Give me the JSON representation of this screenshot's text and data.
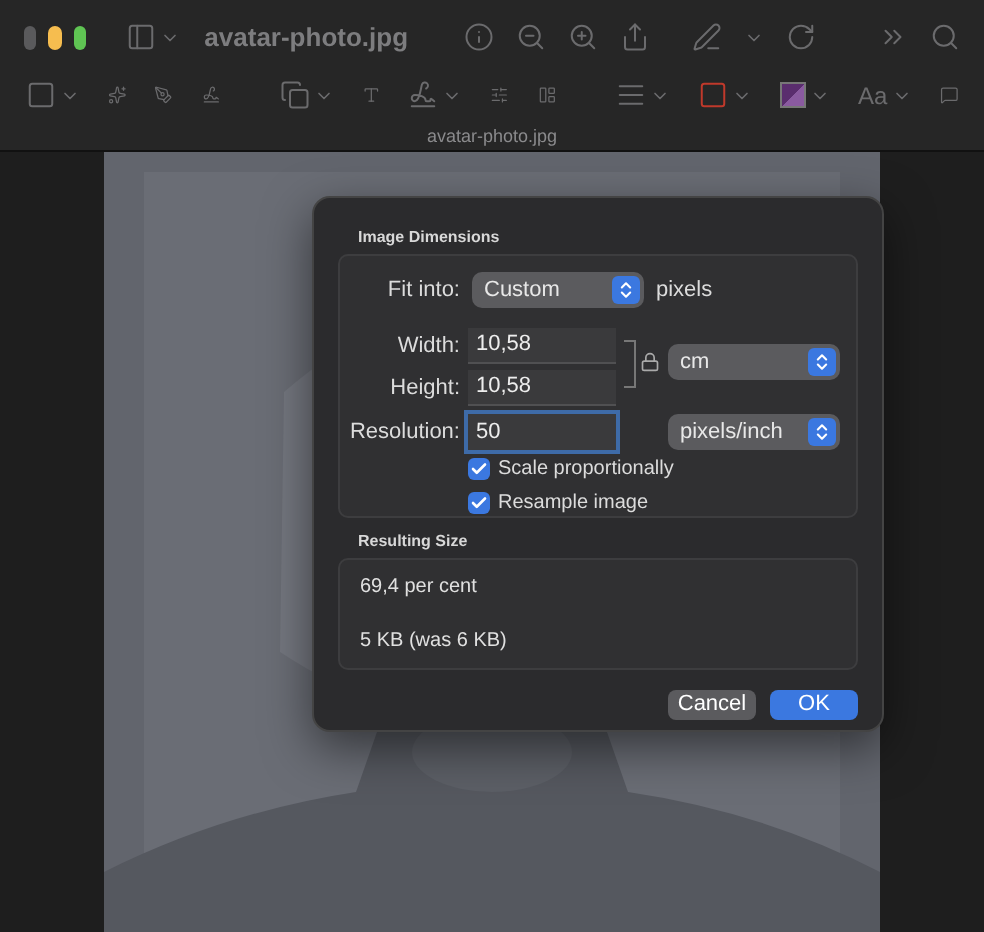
{
  "window": {
    "title": "avatar-photo.jpg"
  },
  "toolbar": {
    "font_button": "Aa"
  },
  "document_label": "avatar-photo.jpg",
  "dialog": {
    "dimensions": {
      "title": "Image Dimensions",
      "fit_into": {
        "label": "Fit into:",
        "value": "Custom",
        "unit": "pixels"
      },
      "width": {
        "label": "Width:",
        "value": "10,58"
      },
      "height": {
        "label": "Height:",
        "value": "10,58"
      },
      "size_unit": {
        "value": "cm"
      },
      "resolution": {
        "label": "Resolution:",
        "value": "50",
        "focused": true
      },
      "resolution_unit": {
        "value": "pixels/inch"
      },
      "options": [
        {
          "label": "Scale proportionally",
          "checked": true
        },
        {
          "label": "Resample image",
          "checked": true
        }
      ]
    },
    "result": {
      "title": "Resulting Size",
      "percent": "69,4 per cent",
      "size": "5 KB (was 6 KB)"
    },
    "buttons": [
      {
        "label": "Cancel",
        "primary": false
      },
      {
        "label": "OK",
        "primary": true
      }
    ]
  }
}
